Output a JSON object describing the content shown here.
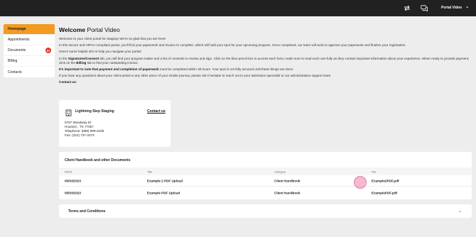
{
  "topbar": {
    "icons": [
      "swap-icon",
      "chat-icon"
    ],
    "user_label": "Portal Video",
    "user_chevron": "⌄"
  },
  "sidebar": {
    "items": [
      {
        "label": "Homepage",
        "active": true
      },
      {
        "label": "Appointments"
      },
      {
        "label": "Documents",
        "badge": "57"
      },
      {
        "label": "Billing"
      },
      {
        "label": "Contacts"
      }
    ]
  },
  "main": {
    "welcome_bold": "Welcome",
    "welcome_rest": " Portal Video",
    "p1": "Welcome to your client portal for Staging! We're so glad that you are here!",
    "p2": "In this secure and HIPAA-compliant portal, you'll find your paperwork and invoice to complete, which will hold your spot for your upcoming program. Once completed, our team will work to approve your paperwork and finalize your registration.",
    "p3": "Here's some helpful info to help you navigate your portal!",
    "p4_a": "In the ",
    "p4_b": "Signatures/Consent",
    "p4_c": " tab, you will find your program intake and a list of consents to review and sign. Click on the blue pencil box to access each form; make sure to read each one fully as they contain important information about your experience. When ready to provide payment, click on the ",
    "p4_d": "Billing",
    "p4_e": " tab to find your outstanding invoice.",
    "p5_a": "It's important to note that payment and completion of paperwork",
    "p5_b": " must be completed within 48 hours. Your spot is not fully secured until these things are done.",
    "p6": "If you have any questions about your client portal or any other piece of your Onsite journey, please don't hesitate to reach out to your admission specialist or our administrative support team.",
    "contact_us": "Contact us:"
  },
  "contact_card": {
    "name": "Lightning Step Staging",
    "link": "Contact us",
    "addr1": "5757 Woodway Dr",
    "addr2": "Houston , TX 77057",
    "phone": "Telephone: (888) 999-2238",
    "fax": "Fax: (222) 737-3373"
  },
  "handbook": {
    "title": "Client Handbook and other Documents",
    "headers": {
      "date": "DATE",
      "title": "Title",
      "category": "Category",
      "file": "File"
    },
    "rows": [
      {
        "date": "05/03/2023",
        "title": "Example 2 PDF Upload",
        "category": "Client Handbook",
        "file": "Example2PDF.pdf"
      },
      {
        "date": "05/03/2023",
        "title": "Example PDF Upload",
        "category": "Client Handbook",
        "file": "ExamplePDF.pdf"
      }
    ]
  },
  "terms": {
    "label": "Terms and Conditions",
    "chevron": "⌄"
  },
  "colors": {
    "topbar": "#212121",
    "accent": "#f39a20",
    "badge": "#e53935",
    "background": "#ededed"
  }
}
